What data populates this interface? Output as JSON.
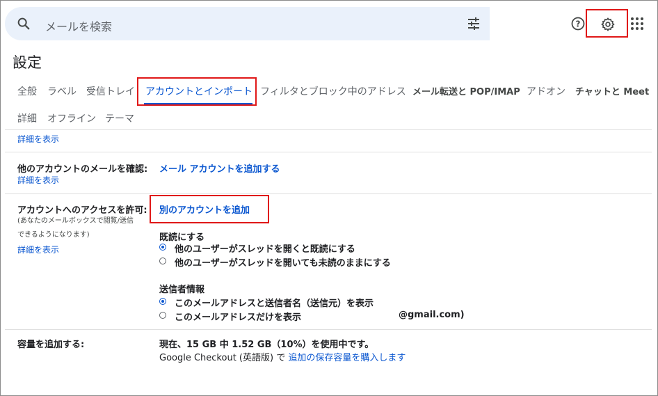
{
  "search": {
    "placeholder": "メールを検索"
  },
  "page_title": "設定",
  "tabs": [
    "全般",
    "ラベル",
    "受信トレイ",
    "アカウントとインポート",
    "フィルタとブロック中のアドレス",
    "メール転送と POP/IMAP",
    "アドオン",
    "チャットと Meet"
  ],
  "tabs_row2": [
    "詳細",
    "オフライン",
    "テーマ"
  ],
  "active_tab": "アカウントとインポート",
  "sections": {
    "top_show_details": "詳細を表示",
    "check_mail": {
      "label": "他のアカウントのメールを確認:",
      "show_details": "詳細を表示",
      "action": "メール アカウントを追加する"
    },
    "grant_access": {
      "label": "アカウントへのアクセスを許可:",
      "note_line1": "(あなたのメールボックスで閲覧/送信",
      "note_line2": "できるようになります)",
      "show_details": "詳細を表示",
      "action": "別のアカウントを追加",
      "mark_read_heading": "既読にする",
      "mark_read_options": [
        {
          "label": "他のユーザーがスレッドを開くと既読にする",
          "checked": true
        },
        {
          "label": "他のユーザーがスレッドを開いても未読のままにする",
          "checked": false
        }
      ],
      "sender_info_heading": "送信者情報",
      "sender_info_options": [
        {
          "label": "このメールアドレスと送信者名（送信元）を表示",
          "checked": true
        },
        {
          "label": "このメールアドレスだけを表示",
          "suffix": "@gmail.com)",
          "checked": false
        }
      ]
    },
    "storage": {
      "label": "容量を追加する:",
      "usage": "現在、15 GB 中 1.52 GB（10%）を使用中です。",
      "checkout_prefix": "Google Checkout (英語版) で",
      "checkout_link": "追加の保存容量を購入します"
    }
  }
}
